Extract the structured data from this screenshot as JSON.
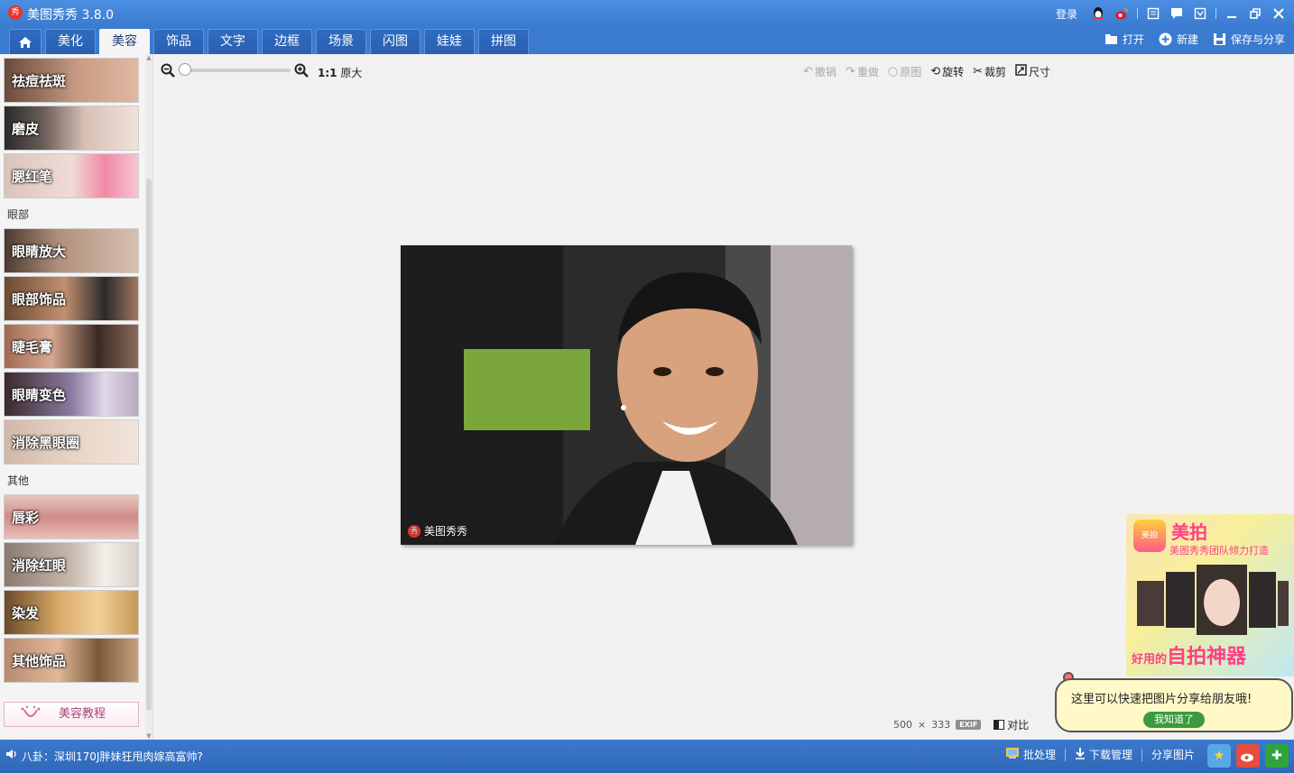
{
  "app": {
    "title": "美图秀秀 3.8.0",
    "logo_text": "秀"
  },
  "window": {
    "login": "登录"
  },
  "tabs": [
    {
      "label": ""
    },
    {
      "label": "美化"
    },
    {
      "label": "美容"
    },
    {
      "label": "饰品"
    },
    {
      "label": "文字"
    },
    {
      "label": "边框"
    },
    {
      "label": "场景"
    },
    {
      "label": "闪图"
    },
    {
      "label": "娃娃"
    },
    {
      "label": "拼图"
    }
  ],
  "file_actions": {
    "open": "打开",
    "new": "新建",
    "save_share": "保存与分享"
  },
  "sidebar": {
    "group_face": [
      "祛痘祛斑",
      "磨皮",
      "腮红笔"
    ],
    "section_eye": "眼部",
    "group_eye": [
      "眼睛放大",
      "眼部饰品",
      "睫毛膏",
      "眼睛变色",
      "消除黑眼圈"
    ],
    "section_other": "其他",
    "group_other": [
      "唇彩",
      "消除红眼",
      "染发",
      "其他饰品"
    ],
    "tutorial": "美容教程"
  },
  "toolbar": {
    "ratio_main": "1:1",
    "ratio_label": "原大",
    "undo": "撤销",
    "redo": "重做",
    "original": "原图",
    "rotate": "旋转",
    "crop": "裁剪",
    "size": "尺寸"
  },
  "photo": {
    "watermark": "美图秀秀"
  },
  "image_info": {
    "width": "500",
    "times": "×",
    "height": "333",
    "exif": "EXIF",
    "compare": "对比"
  },
  "ad": {
    "logo_text": "美拍",
    "title": "美拍",
    "subtitle": "美图秀秀团队倾力打造",
    "slogan_prefix": "好用的",
    "slogan_main": "自拍神器"
  },
  "tooltip": {
    "text": "这里可以快速把图片分享给朋友哦!",
    "button": "我知道了"
  },
  "statusbar": {
    "news": "八卦：深圳170J胖妹狂甩肉嫁高富帅?",
    "batch": "批处理",
    "download": "下载管理",
    "share": "分享图片"
  },
  "colors": {
    "titlebar": "#3a7bd0",
    "active_tab": "#f5f5f5",
    "accent_pink": "#ff3f86"
  }
}
